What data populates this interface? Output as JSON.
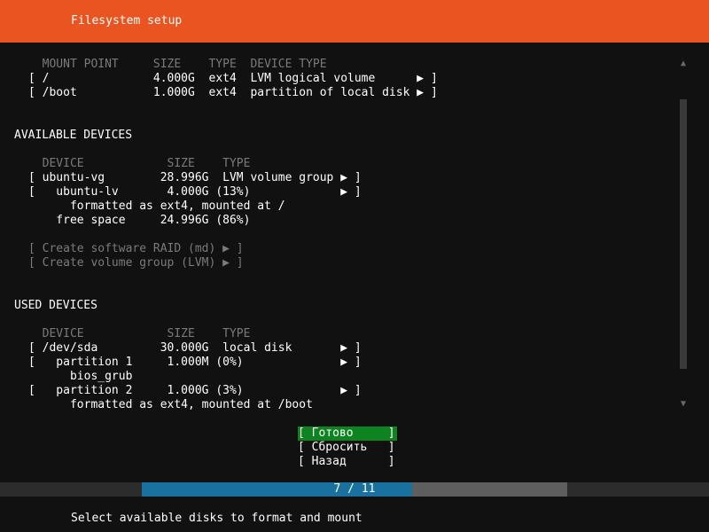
{
  "header": {
    "title": "Filesystem setup"
  },
  "mounts": {
    "columns": "  MOUNT POINT     SIZE    TYPE  DEVICE TYPE",
    "rows": [
      "[ /               4.000G  ext4  LVM logical volume      ▶ ]",
      "[ /boot           1.000G  ext4  partition of local disk ▶ ]"
    ]
  },
  "available": {
    "heading": "AVAILABLE DEVICES",
    "columns": "  DEVICE            SIZE    TYPE",
    "rows": [
      "[ ubuntu-vg        28.996G  LVM volume group ▶ ]",
      "[   ubuntu-lv       4.000G (13%)             ▶ ]",
      "      formatted as ext4, mounted at /",
      "    free space     24.996G (86%)"
    ],
    "actions": [
      "[ Create software RAID (md) ▶ ]",
      "[ Create volume group (LVM) ▶ ]"
    ]
  },
  "used": {
    "heading": "USED DEVICES",
    "columns": "  DEVICE            SIZE    TYPE",
    "rows": [
      "[ /dev/sda         30.000G  local disk       ▶ ]",
      "[   partition 1     1.000M (0%)              ▶ ]",
      "      bios_grub",
      "[   partition 2     1.000G (3%)              ▶ ]",
      "      formatted as ext4, mounted at /boot"
    ]
  },
  "buttons": {
    "done": "[ Готово     ]",
    "reset": "[ Сбросить   ]",
    "back": "[ Назад      ]"
  },
  "progress": {
    "label": "7 / 11",
    "fraction": 0.636
  },
  "footer": {
    "hint": "Select available disks to format and mount"
  },
  "colors": {
    "header": "#E95420",
    "done_button": "#0E8420",
    "progress_fill": "#19719F"
  }
}
